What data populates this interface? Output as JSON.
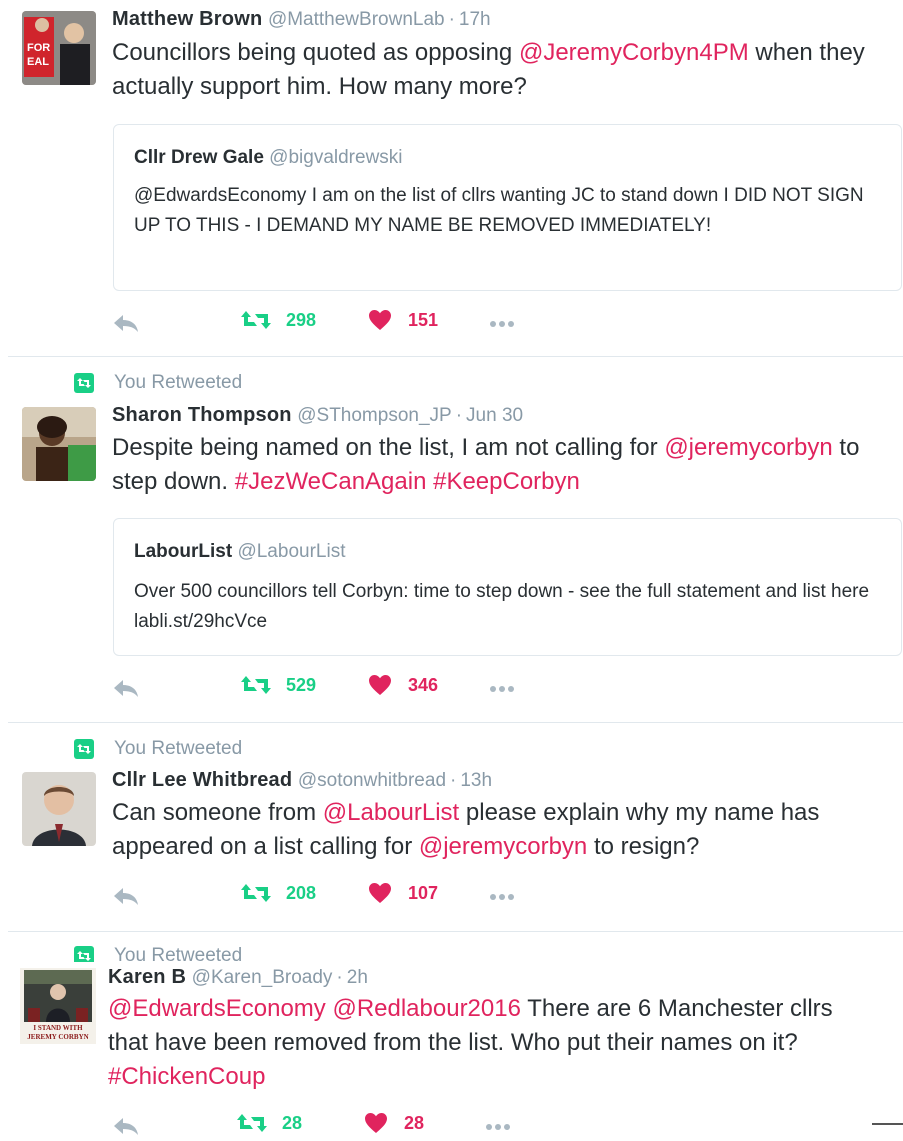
{
  "tweets": [
    {
      "retweet_label": "",
      "name": "Matthew Brown",
      "handle": "@MatthewBrownLab",
      "time": "17h",
      "text": [
        {
          "t": "Councillors being quoted as opposing ",
          "link": false
        },
        {
          "t": "@JeremyCorbyn4PM",
          "link": true
        },
        {
          "t": " when they actually support him.  How many more?",
          "link": false
        }
      ],
      "quote": {
        "name": "Cllr Drew Gale",
        "handle": "@bigvaldrewski",
        "text": "@EdwardsEconomy I am on the list of cllrs wanting JC to stand down I DID NOT SIGN UP TO THIS - I DEMAND MY NAME BE REMOVED IMMEDIATELY!"
      },
      "retweets": "298",
      "likes": "151"
    },
    {
      "retweet_label": "You Retweeted",
      "name": "Sharon Thompson",
      "handle": "@SThompson_JP",
      "time": "Jun 30",
      "text": [
        {
          "t": "Despite being named on the list, I am not calling for ",
          "link": false
        },
        {
          "t": "@jeremycorbyn",
          "link": true
        },
        {
          "t": " to step down. ",
          "link": false
        },
        {
          "t": "#JezWeCanAgain",
          "link": true
        },
        {
          "t": " ",
          "link": false
        },
        {
          "t": "#KeepCorbyn",
          "link": true
        }
      ],
      "quote": {
        "name": "LabourList",
        "handle": "@LabourList",
        "text": "Over 500 councillors tell Corbyn: time to step down - see the full statement and list here labli.st/29hcVce"
      },
      "retweets": "529",
      "likes": "346"
    },
    {
      "retweet_label": "You Retweeted",
      "name": "Cllr Lee Whitbread",
      "handle": "@sotonwhitbread",
      "time": "13h",
      "text": [
        {
          "t": "Can someone from ",
          "link": false
        },
        {
          "t": "@LabourList",
          "link": true
        },
        {
          "t": " please explain why my name has appeared on a list calling for ",
          "link": false
        },
        {
          "t": "@jeremycorbyn",
          "link": true
        },
        {
          "t": " to resign?",
          "link": false
        }
      ],
      "retweets": "208",
      "likes": "107"
    },
    {
      "retweet_label": "You Retweeted",
      "name": "Karen B",
      "handle": "@Karen_Broady",
      "time": "2h",
      "avatar_caption": "I STAND WITH JEREMY CORBYN",
      "text": [
        {
          "t": "@EdwardsEconomy",
          "link": true
        },
        {
          "t": " ",
          "link": false
        },
        {
          "t": "@Redlabour2016",
          "link": true
        },
        {
          "t": " There are 6 Manchester cllrs that have been removed from the list. Who put their names on it? ",
          "link": false
        },
        {
          "t": "#ChickenCoup",
          "link": true
        }
      ],
      "retweets": "28",
      "likes": "28"
    }
  ],
  "colors": {
    "link": "#e0245e",
    "retweet_green": "#19cf86",
    "like_red": "#e0245e",
    "muted": "#8899a6",
    "text": "#292f33"
  }
}
